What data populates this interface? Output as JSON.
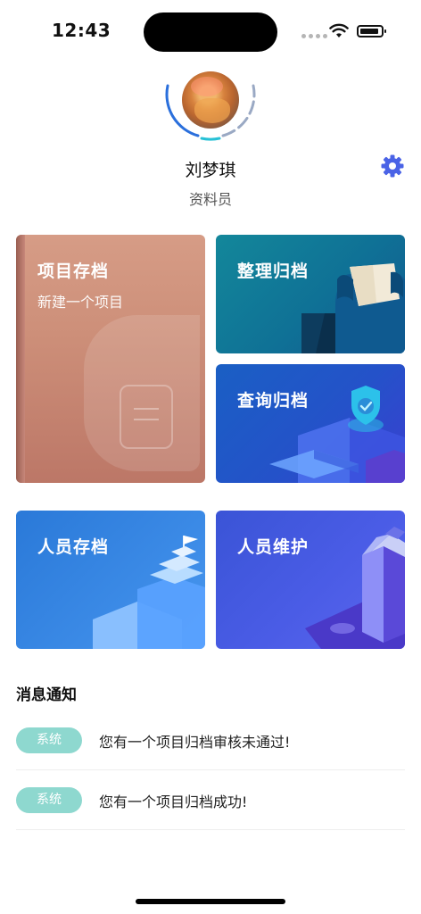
{
  "status_bar": {
    "time": "12:43"
  },
  "profile": {
    "name": "刘梦琪",
    "role": "资料员"
  },
  "cards": {
    "archive": {
      "title": "项目存档",
      "subtitle": "新建一个项目"
    },
    "organize": {
      "title": "整理归档"
    },
    "query": {
      "title": "查询归档"
    },
    "staff_archive": {
      "title": "人员存档"
    },
    "staff_maintenance": {
      "title": "人员维护"
    }
  },
  "notifications": {
    "title": "消息通知",
    "items": [
      {
        "tag": "系统",
        "text": "您有一个项目归档审核未通过!"
      },
      {
        "tag": "系统",
        "text": "您有一个项目归档成功!"
      }
    ]
  },
  "colors": {
    "accent": "#4a63e6",
    "tag_bg": "#8ed8cf"
  }
}
